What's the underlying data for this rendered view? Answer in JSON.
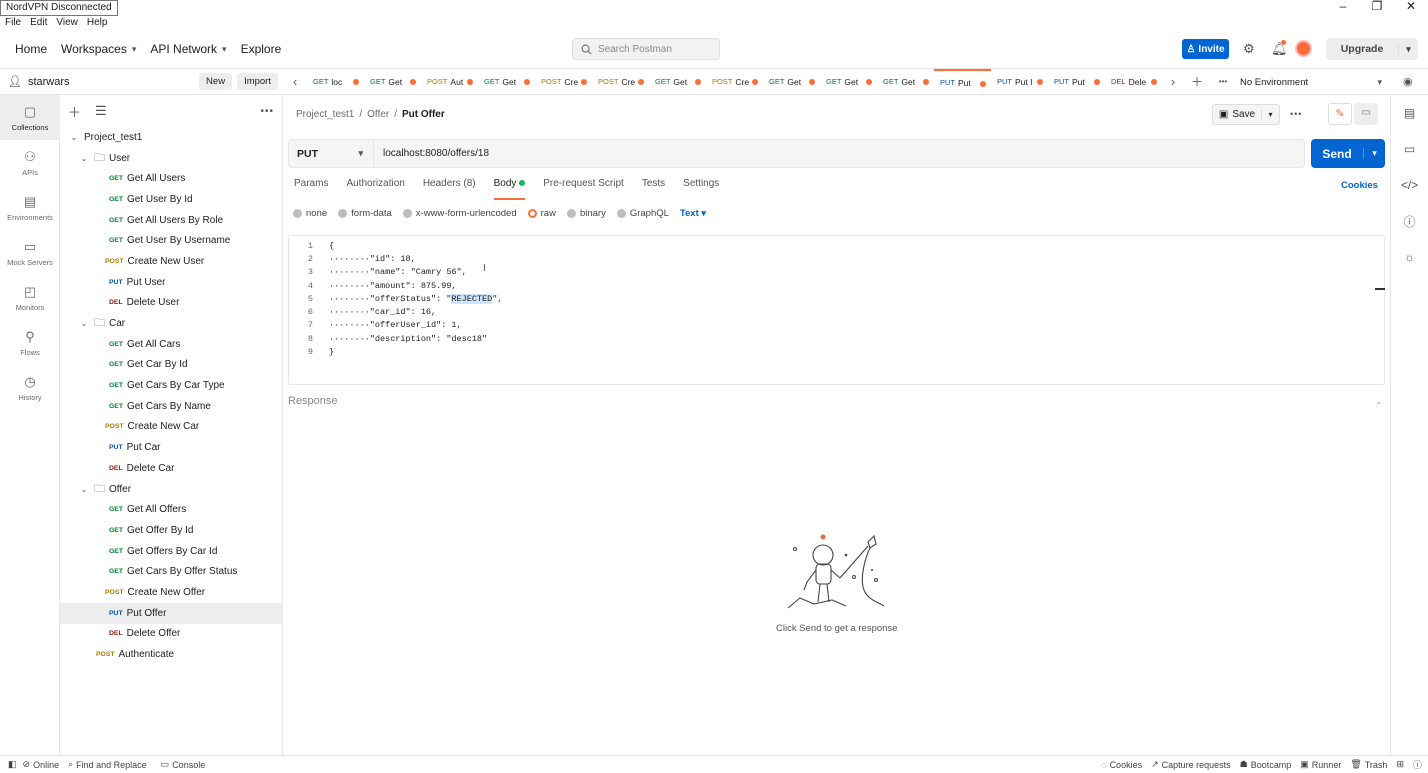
{
  "tooltip": "NordVPN Disconnected",
  "menu": [
    "File",
    "Edit",
    "View",
    "Help"
  ],
  "window_controls": [
    "–",
    "❐",
    "✕"
  ],
  "topnav": {
    "home": "Home",
    "workspaces": "Workspaces",
    "api_network": "API Network",
    "explore": "Explore",
    "search_placeholder": "Search Postman",
    "invite": "Invite",
    "upgrade": "Upgrade"
  },
  "workspace": {
    "name": "starwars",
    "new": "New",
    "import": "Import"
  },
  "rail": [
    {
      "label": "Collections",
      "icon": "collections-icon"
    },
    {
      "label": "APIs",
      "icon": "apis-icon"
    },
    {
      "label": "Environments",
      "icon": "environments-icon"
    },
    {
      "label": "Mock Servers",
      "icon": "mock-servers-icon"
    },
    {
      "label": "Monitors",
      "icon": "monitors-icon"
    },
    {
      "label": "Flows",
      "icon": "flows-icon"
    },
    {
      "label": "History",
      "icon": "history-icon"
    }
  ],
  "tree": {
    "collection": "Project_test1",
    "folders": [
      {
        "name": "User",
        "items": [
          {
            "m": "GET",
            "label": "Get All Users"
          },
          {
            "m": "GET",
            "label": "Get User By Id"
          },
          {
            "m": "GET",
            "label": "Get All Users By Role"
          },
          {
            "m": "GET",
            "label": "Get User By Username"
          },
          {
            "m": "POST",
            "label": "Create New User"
          },
          {
            "m": "PUT",
            "label": "Put User"
          },
          {
            "m": "DEL",
            "label": "Delete User"
          }
        ]
      },
      {
        "name": "Car",
        "items": [
          {
            "m": "GET",
            "label": "Get All Cars"
          },
          {
            "m": "GET",
            "label": "Get Car By Id"
          },
          {
            "m": "GET",
            "label": "Get Cars By Car Type"
          },
          {
            "m": "GET",
            "label": "Get Cars By Name"
          },
          {
            "m": "POST",
            "label": "Create New Car"
          },
          {
            "m": "PUT",
            "label": "Put Car"
          },
          {
            "m": "DEL",
            "label": "Delete Car"
          }
        ]
      },
      {
        "name": "Offer",
        "items": [
          {
            "m": "GET",
            "label": "Get All Offers"
          },
          {
            "m": "GET",
            "label": "Get Offer By Id"
          },
          {
            "m": "GET",
            "label": "Get Offers By Car Id"
          },
          {
            "m": "GET",
            "label": "Get Cars By Offer Status"
          },
          {
            "m": "POST",
            "label": "Create New Offer"
          },
          {
            "m": "PUT",
            "label": "Put Offer",
            "selected": true
          },
          {
            "m": "DEL",
            "label": "Delete Offer"
          }
        ]
      }
    ],
    "root_item": {
      "m": "POST",
      "label": "Authenticate"
    }
  },
  "tabs": [
    {
      "m": "GET",
      "label": "loc"
    },
    {
      "m": "GET",
      "label": "Get"
    },
    {
      "m": "POST",
      "label": "Aut"
    },
    {
      "m": "GET",
      "label": "Get"
    },
    {
      "m": "POST",
      "label": "Cre"
    },
    {
      "m": "POST",
      "label": "Cre"
    },
    {
      "m": "GET",
      "label": "Get"
    },
    {
      "m": "POST",
      "label": "Cre"
    },
    {
      "m": "GET",
      "label": "Get"
    },
    {
      "m": "GET",
      "label": "Get"
    },
    {
      "m": "GET",
      "label": "Get"
    },
    {
      "m": "PUT",
      "label": "Put",
      "active": true
    },
    {
      "m": "PUT",
      "label": "Put I"
    },
    {
      "m": "PUT",
      "label": "Put"
    },
    {
      "m": "DEL",
      "label": "Dele"
    }
  ],
  "environment": "No Environment",
  "breadcrumb": {
    "collection": "Project_test1",
    "folder": "Offer",
    "request": "Put Offer"
  },
  "save": "Save",
  "request": {
    "method": "PUT",
    "url": "localhost:8080/offers/18",
    "send": "Send"
  },
  "req_tabs": [
    "Params",
    "Authorization",
    "Headers (8)",
    "Body",
    "Pre-request Script",
    "Tests",
    "Settings"
  ],
  "cookies": "Cookies",
  "body_options": [
    "none",
    "form-data",
    "x-www-form-urlencoded",
    "raw",
    "binary",
    "GraphQL"
  ],
  "body_type": "Text",
  "code_lines": [
    {
      "n": "1",
      "pre": "{",
      "hl": "",
      "post": ""
    },
    {
      "n": "2",
      "pre": "········\"id\": 18,",
      "hl": "",
      "post": ""
    },
    {
      "n": "3",
      "pre": "········\"name\": \"Camry 56\",",
      "hl": "",
      "post": ""
    },
    {
      "n": "4",
      "pre": "········\"amount\": 875.99,",
      "hl": "",
      "post": ""
    },
    {
      "n": "5",
      "pre": "········\"offerStatus\": \"",
      "hl": "REJECTED",
      "post": "\","
    },
    {
      "n": "6",
      "pre": "········\"car_id\": 16,",
      "hl": "",
      "post": ""
    },
    {
      "n": "7",
      "pre": "········\"offerUser_id\": 1,",
      "hl": "",
      "post": ""
    },
    {
      "n": "8",
      "pre": "········\"description\": \"desc18\"",
      "hl": "",
      "post": ""
    },
    {
      "n": "9",
      "pre": "}",
      "hl": "",
      "post": ""
    }
  ],
  "response": {
    "title": "Response",
    "hint": "Click Send to get a response"
  },
  "statusbar": {
    "online": "Online",
    "find": "Find and Replace",
    "console": "Console",
    "cookies": "Cookies",
    "capture": "Capture requests",
    "bootcamp": "Bootcamp",
    "runner": "Runner",
    "trash": "Trash"
  },
  "colors": {
    "accent": "#ff6c37",
    "primary": "#0265d2",
    "get": "#007f31",
    "post": "#ad7a03",
    "put": "#0053b8",
    "del": "#8e1a10"
  }
}
